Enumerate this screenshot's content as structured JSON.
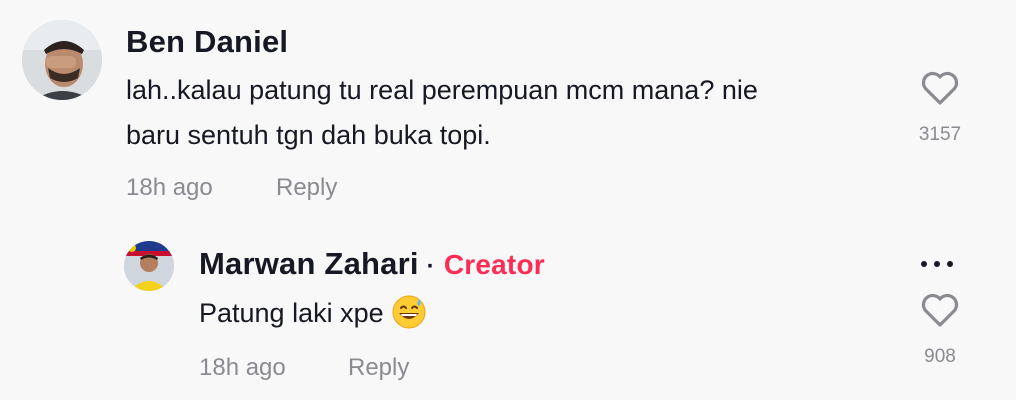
{
  "comments": [
    {
      "author": "Ben Daniel",
      "text_line1": "lah..kalau patung tu real perempuan mcm mana? nie",
      "text_line2": "baru sentuh tgn dah buka topi.",
      "time": "18h ago",
      "reply_label": "Reply",
      "like_count": "3157",
      "avatar_icon": "person-hand-on-face-avatar"
    }
  ],
  "reply": {
    "author": "Marwan Zahari",
    "separator": "·",
    "badge": "Creator",
    "text": "Patung laki xpe",
    "emoji_icon": "grinning-sweat-emoji",
    "time": "18h ago",
    "reply_label": "Reply",
    "like_count": "908",
    "avatar_icon": "person-yellow-shirt-avatar"
  },
  "colors": {
    "background": "#f8f8f8",
    "text": "#161823",
    "muted": "#8a8b91",
    "creator_badge": "#fe2c55"
  }
}
